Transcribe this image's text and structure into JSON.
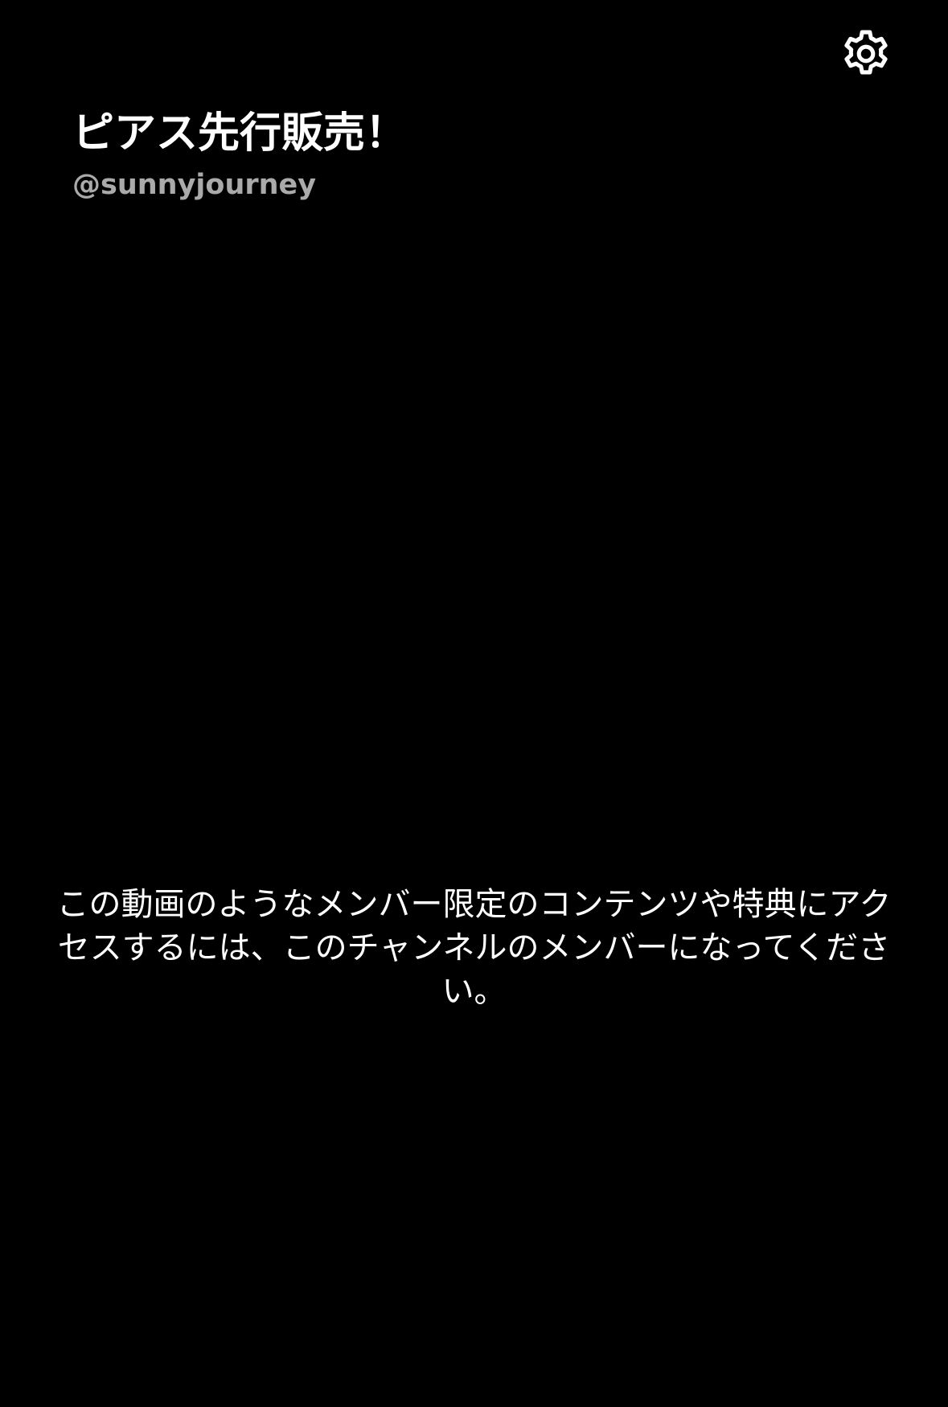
{
  "header": {
    "title": "ピアス先行販売！",
    "channel_handle": "@sunnyjourney"
  },
  "toolbar": {
    "settings_icon": "gear-icon"
  },
  "main": {
    "members_only_message": "この動画のようなメンバー限定のコンテンツや特典にアクセスするには、このチャンネルのメンバーになってください。"
  },
  "colors": {
    "background": "#000000",
    "text_primary": "#ffffff",
    "text_secondary": "#aaaaaa"
  }
}
